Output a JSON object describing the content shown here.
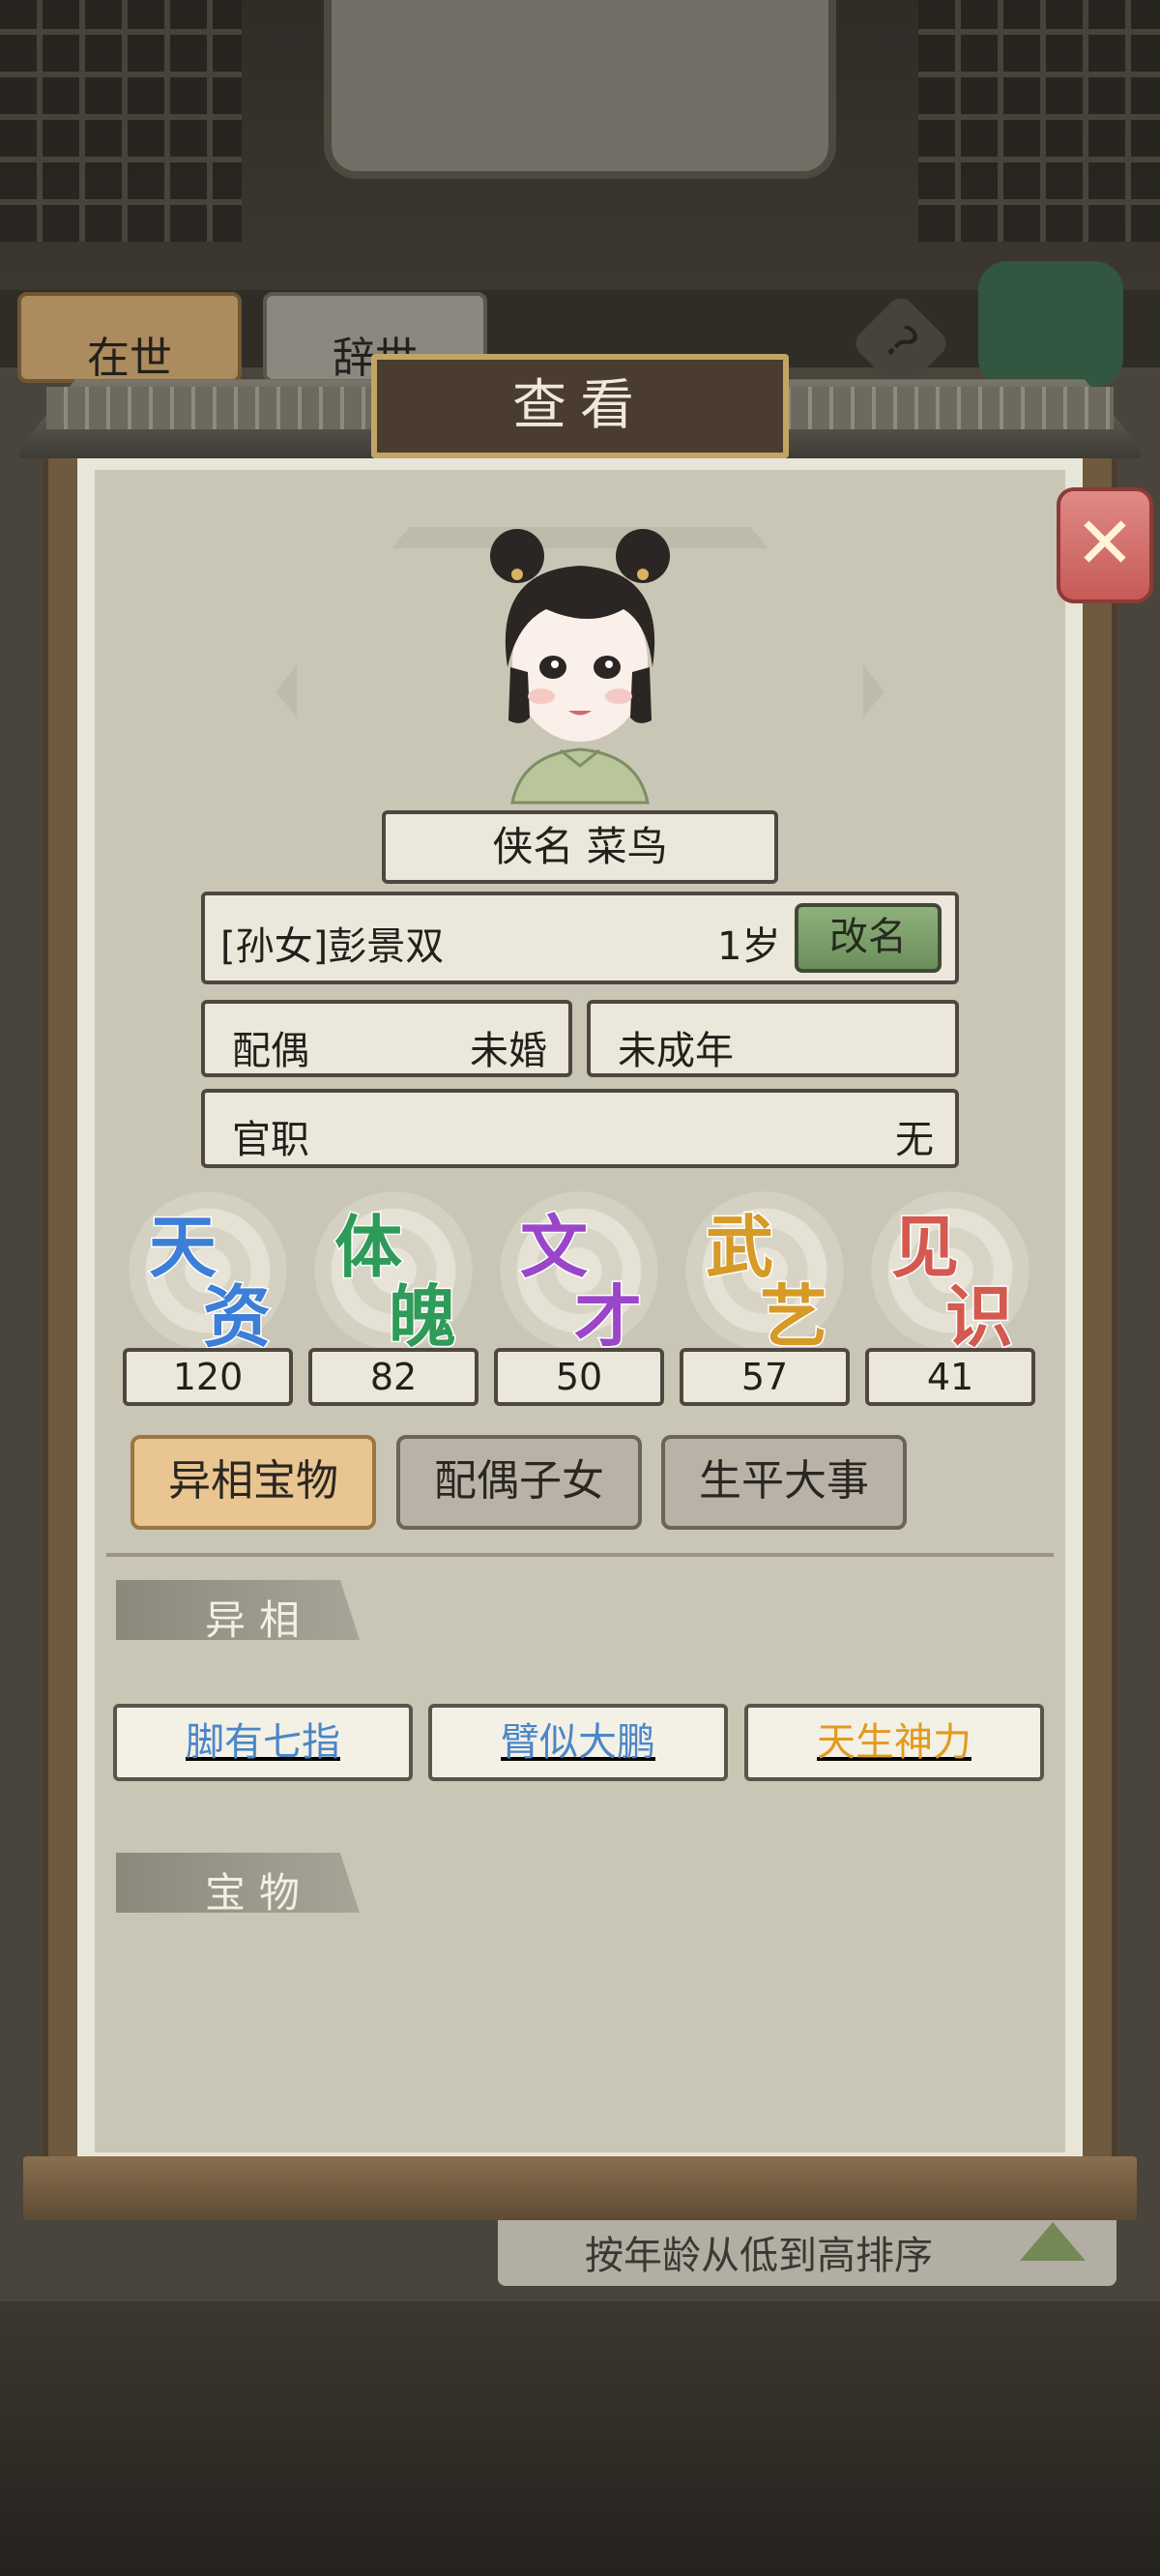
{
  "background": {
    "tabs": [
      "在世",
      "辞世"
    ],
    "sort_label": "按年龄从低到高排序"
  },
  "modal": {
    "title": "查看",
    "close_icon": "close-icon",
    "hero_name": "侠名 菜鸟",
    "identity": "[孙女]彭景双",
    "age": "1岁",
    "rename_label": "改名",
    "spouse_label": "配偶",
    "spouse_value": "未婚",
    "adult_status": "未成年",
    "office_label": "官职",
    "office_value": "无",
    "stats": [
      {
        "c1": "天",
        "c2": "资",
        "value": "120",
        "color": "#3d7fd6"
      },
      {
        "c1": "体",
        "c2": "魄",
        "value": "82",
        "color": "#2f9b58"
      },
      {
        "c1": "文",
        "c2": "才",
        "value": "50",
        "color": "#9b46c9"
      },
      {
        "c1": "武",
        "c2": "艺",
        "value": "57",
        "color": "#d69a26"
      },
      {
        "c1": "见",
        "c2": "识",
        "value": "41",
        "color": "#d45a4f"
      }
    ],
    "tabs": [
      "异相宝物",
      "配偶子女",
      "生平大事"
    ],
    "section_traits": "异相",
    "traits": [
      {
        "label": "脚有七指",
        "color": "#4a86c8"
      },
      {
        "label": "臂似大鹏",
        "color": "#4a86c8"
      },
      {
        "label": "天生神力",
        "color": "#e39a1f"
      }
    ],
    "section_treasures": "宝物"
  }
}
